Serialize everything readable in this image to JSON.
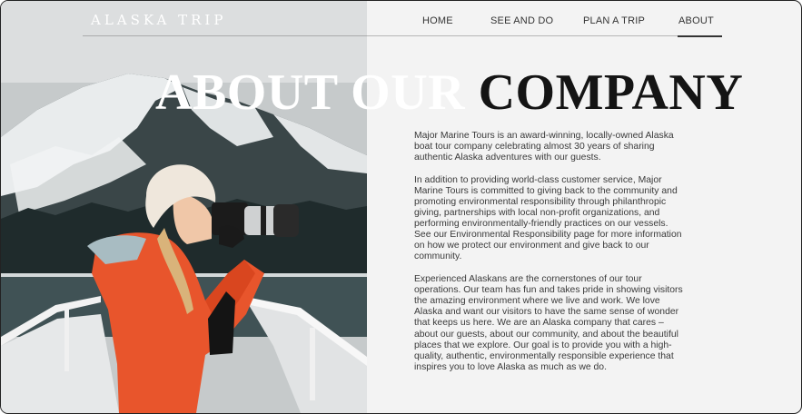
{
  "brand": {
    "name": "ALASKA TRIP"
  },
  "nav": {
    "items": [
      {
        "label": "HOME"
      },
      {
        "label": "SEE AND DO"
      },
      {
        "label": "PLAN A TRIP"
      },
      {
        "label": "ABOUT",
        "active": true
      }
    ]
  },
  "page": {
    "title_part_a": "ABOUT OUR ",
    "title_part_b": "COMPANY",
    "paragraphs": [
      "Major Marine Tours is an award-winning, locally-owned Alaska boat tour company celebrating almost 30 years of sharing authentic Alaska adventures with our guests.",
      "In addition to providing world-class customer service, Major Marine Tours is committed to giving back to the community and promoting environmental responsibility through philanthropic giving, partnerships with local non-profit organizations, and performing environmentally-friendly practices on our vessels. See our Environmental Responsibility page for more information on how we protect our environment and give back to our community.",
      "Experienced Alaskans are the cornerstones of our tour operations. Our team has fun and takes pride in showing visitors the amazing environment where we live and work. We love Alaska and want our visitors to have the same sense of wonder that keeps us here. We are an Alaska company that cares – about our guests, about our community, and about the beautiful places that we explore. Our goal is to provide you with a high-quality, authentic, environmentally responsible experience that inspires you to love Alaska as much as we do."
    ]
  },
  "image": {
    "subject": "photographer-on-boat-photo"
  },
  "colors": {
    "background": "#f3f3f3",
    "text": "#3a3a3a",
    "title": "#141414"
  }
}
